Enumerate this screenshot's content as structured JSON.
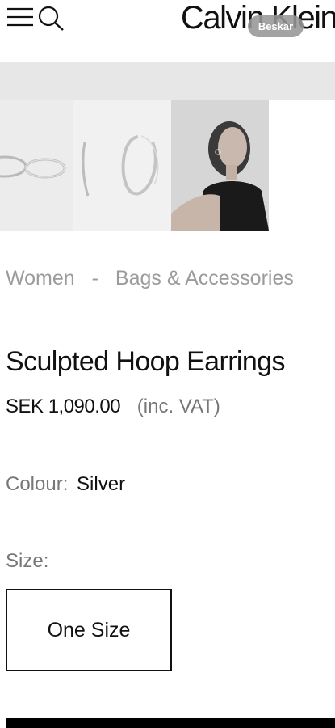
{
  "header": {
    "brand": "Calvin Klein",
    "crop_badge": "Beskär",
    "menu_icon": "hamburger-menu-icon",
    "search_icon": "search-icon"
  },
  "gallery": {
    "images": [
      {
        "name": "product-image-hoops-side"
      },
      {
        "name": "product-image-hoops-front"
      },
      {
        "name": "product-image-model"
      }
    ]
  },
  "breadcrumb": {
    "items": [
      "Women",
      "Bags & Accessories"
    ],
    "separator": "-"
  },
  "product": {
    "title": "Sculpted Hoop Earrings",
    "price": "SEK 1,090.00",
    "vat_note": "(inc. VAT)",
    "colour_label": "Colour:",
    "colour_value": "Silver",
    "size_label": "Size:",
    "size_options": [
      "One Size"
    ]
  },
  "colors": {
    "text_primary": "#111111",
    "text_secondary": "#777777",
    "band_gray": "#e7e7e7",
    "button_black": "#000000"
  }
}
